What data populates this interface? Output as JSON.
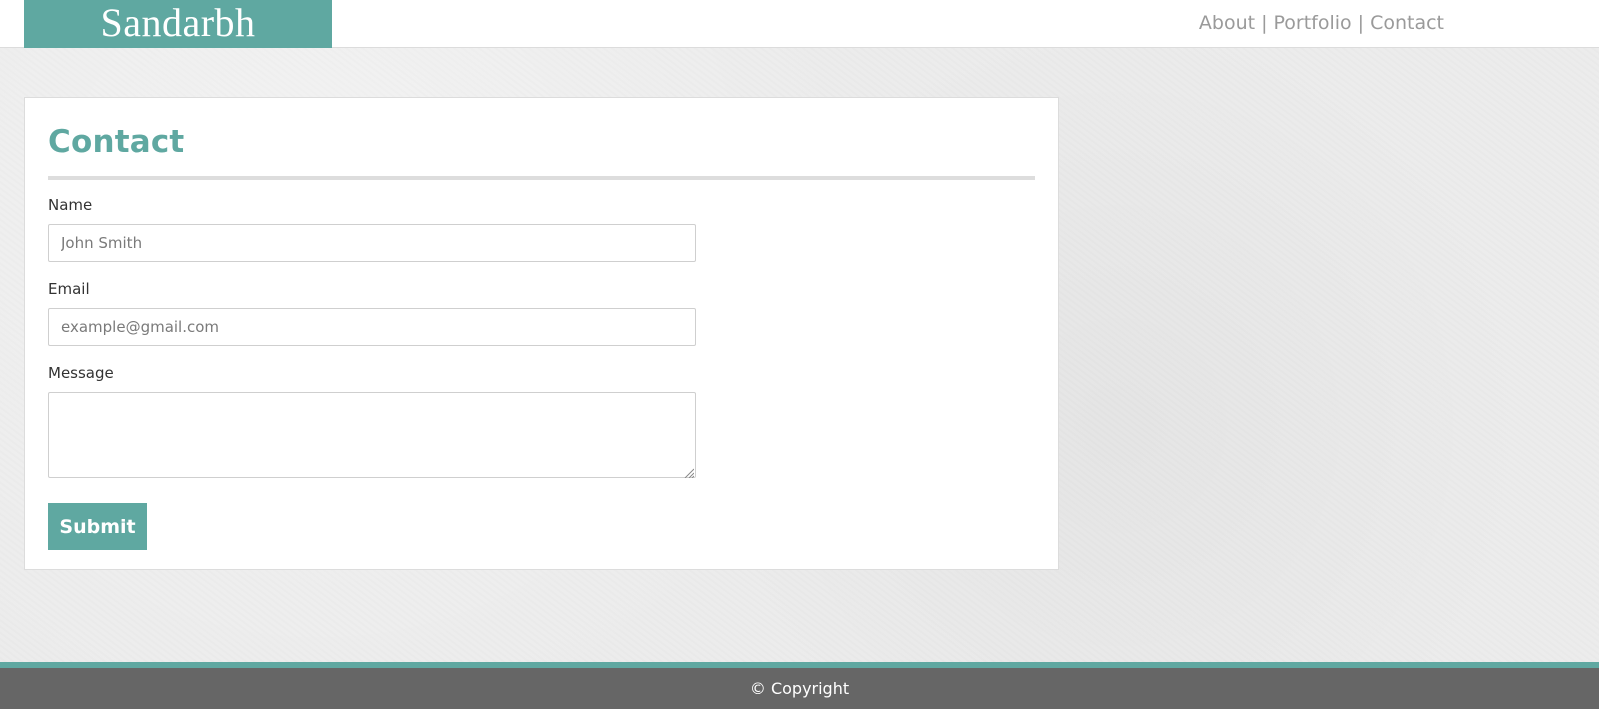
{
  "header": {
    "brand": "Sandarbh",
    "nav": {
      "about": "About",
      "portfolio": "Portfolio",
      "contact": "Contact",
      "separator": "|"
    }
  },
  "contact": {
    "title": "Contact",
    "fields": {
      "name_label": "Name",
      "name_placeholder": "John Smith",
      "email_label": "Email",
      "email_placeholder": "example@gmail.com",
      "message_label": "Message"
    },
    "submit_label": "Submit"
  },
  "footer": {
    "copyright": "© Copyright"
  },
  "colors": {
    "accent": "#5fa8a1",
    "footer_bg": "#666666",
    "page_bg": "#ececec"
  }
}
